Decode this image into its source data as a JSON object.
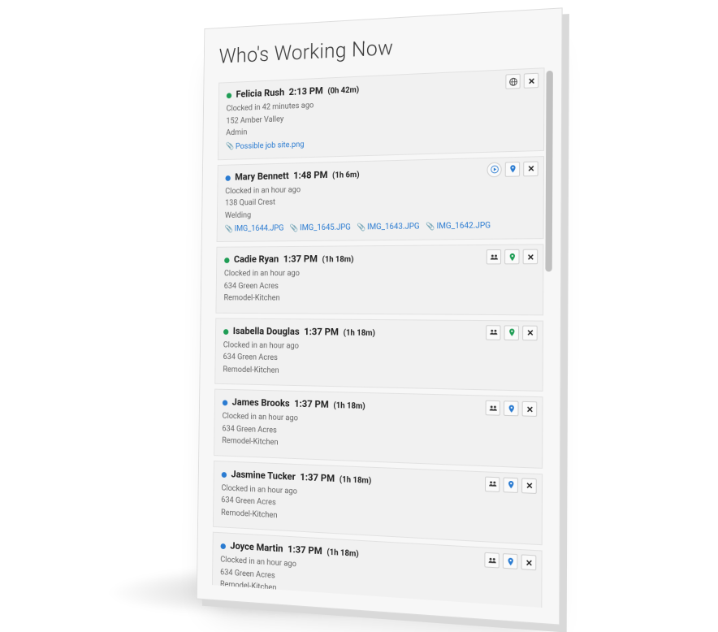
{
  "title": "Who's Working Now",
  "entries": [
    {
      "dot": "green",
      "name": "Felicia Rush",
      "time": "2:13 PM",
      "duration": "(0h 42m)",
      "clocked": "Clocked in 42 minutes ago",
      "location": "152 Amber Valley",
      "role": "Admin",
      "attachments": [
        "Possible job site.png"
      ],
      "icons": [
        "globe",
        "close"
      ]
    },
    {
      "dot": "blue",
      "name": "Mary Bennett",
      "time": "1:48 PM",
      "duration": "(1h 6m)",
      "clocked": "Clocked in an hour ago",
      "location": "138 Quail Crest",
      "role": "Welding",
      "attachments": [
        "IMG_1644.JPG",
        "IMG_1645.JPG",
        "IMG_1643.JPG",
        "IMG_1642.JPG"
      ],
      "icons": [
        "play",
        "pin-blue",
        "close"
      ]
    },
    {
      "dot": "green",
      "name": "Cadie Ryan",
      "time": "1:37 PM",
      "duration": "(1h 18m)",
      "clocked": "Clocked in an hour ago",
      "location": "634 Green Acres",
      "role": "Remodel-Kitchen",
      "attachments": [],
      "icons": [
        "group",
        "pin-green",
        "close"
      ]
    },
    {
      "dot": "green",
      "name": "Isabella Douglas",
      "time": "1:37 PM",
      "duration": "(1h 18m)",
      "clocked": "Clocked in an hour ago",
      "location": "634 Green Acres",
      "role": "Remodel-Kitchen",
      "attachments": [],
      "icons": [
        "group",
        "pin-green",
        "close"
      ]
    },
    {
      "dot": "blue",
      "name": "James Brooks",
      "time": "1:37 PM",
      "duration": "(1h 18m)",
      "clocked": "Clocked in an hour ago",
      "location": "634 Green Acres",
      "role": "Remodel-Kitchen",
      "attachments": [],
      "icons": [
        "group",
        "pin-blue",
        "close"
      ]
    },
    {
      "dot": "blue",
      "name": "Jasmine Tucker",
      "time": "1:37 PM",
      "duration": "(1h 18m)",
      "clocked": "Clocked in an hour ago",
      "location": "634 Green Acres",
      "role": "Remodel-Kitchen",
      "attachments": [],
      "icons": [
        "group",
        "pin-blue",
        "close"
      ]
    },
    {
      "dot": "blue",
      "name": "Joyce Martin",
      "time": "1:37 PM",
      "duration": "(1h 18m)",
      "clocked": "Clocked in an hour ago",
      "location": "634 Green Acres",
      "role": "Remodel-Kitchen",
      "attachments": [],
      "icons": [
        "group",
        "pin-blue",
        "close"
      ]
    }
  ]
}
